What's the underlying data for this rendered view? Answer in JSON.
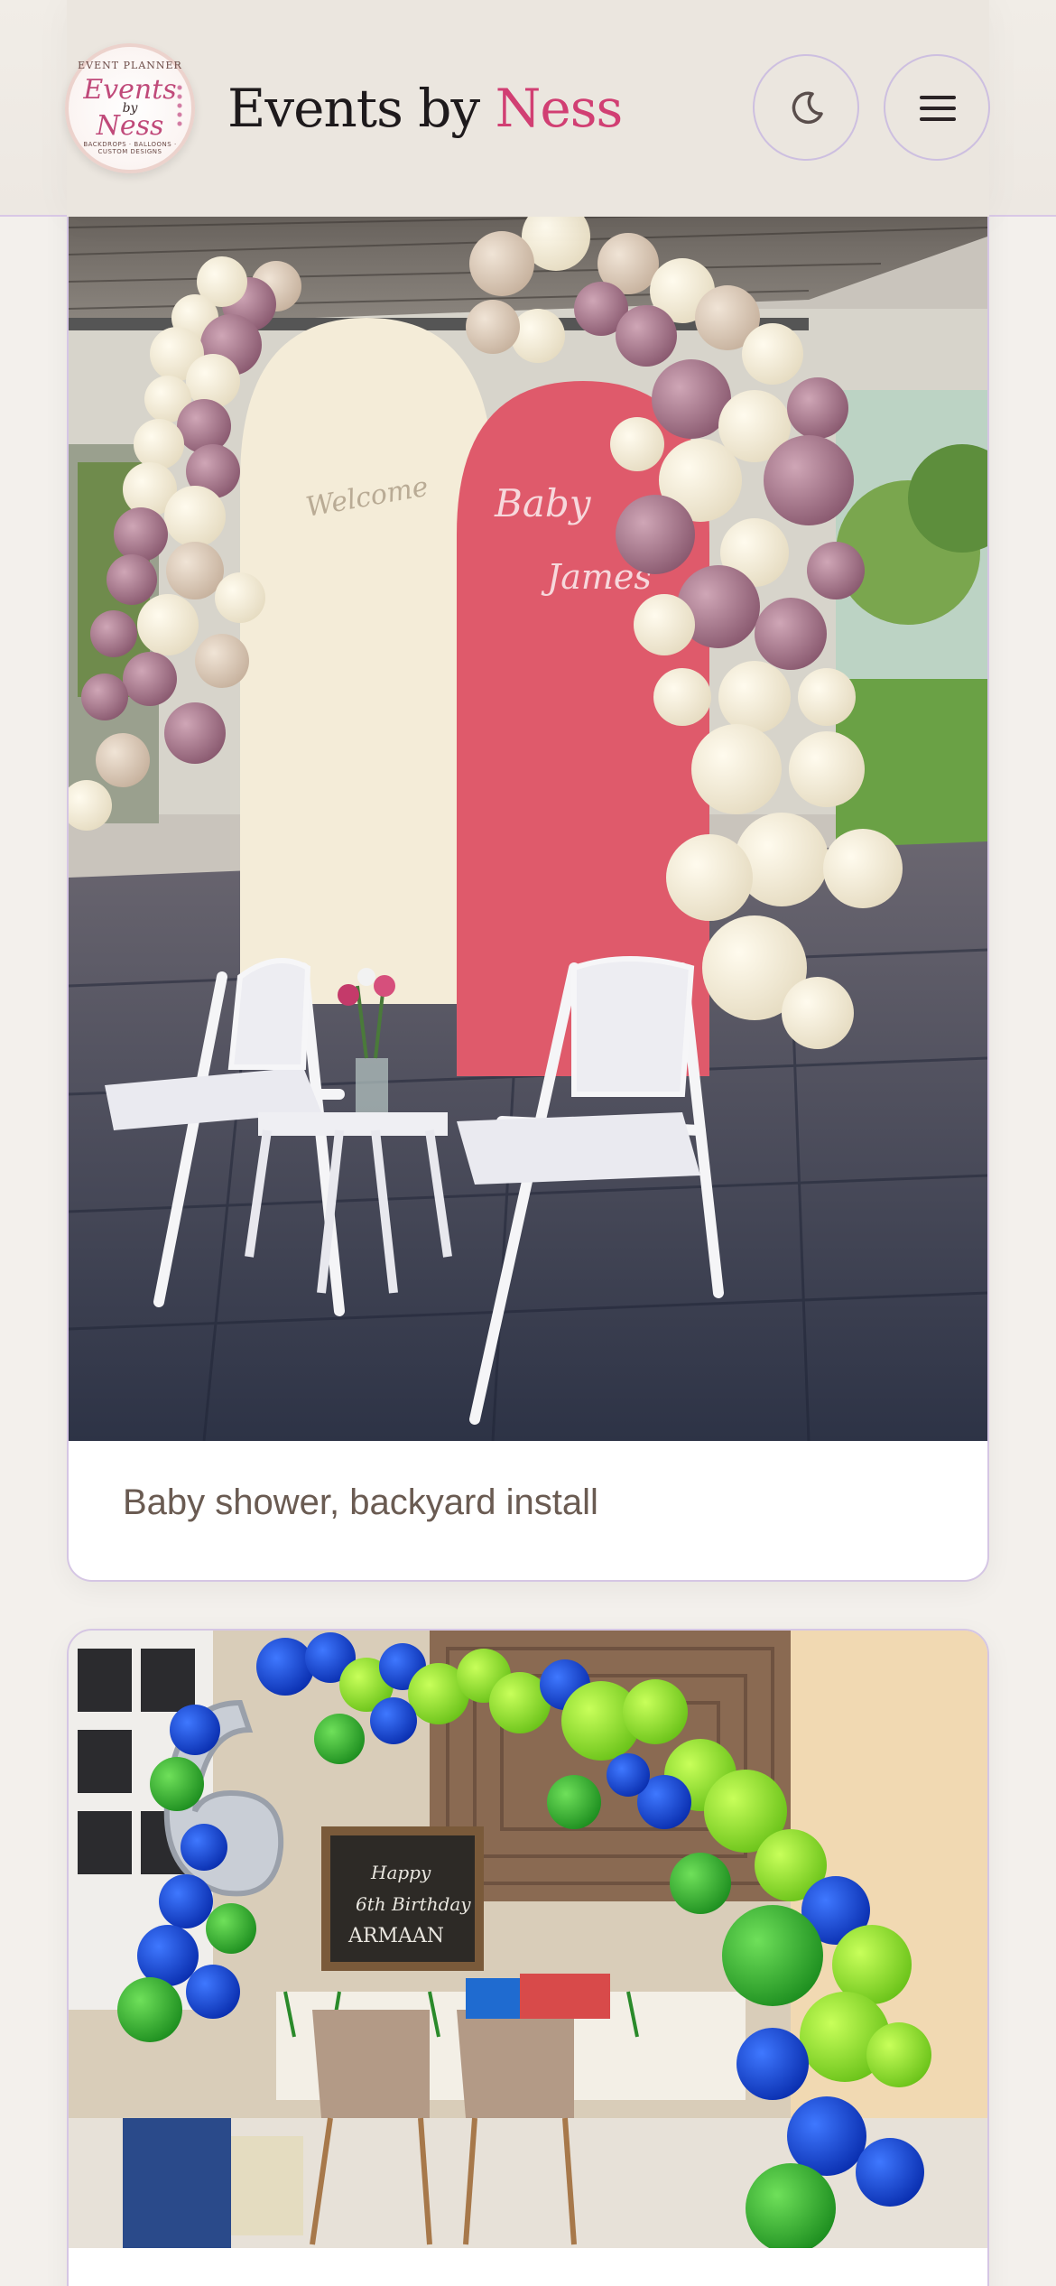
{
  "header": {
    "brand_prefix": "Events by ",
    "brand_accent": "Ness",
    "logo": {
      "top_text": "EVENT PLANNER",
      "script_line1": "Events",
      "script_by": "by",
      "script_line2": "Ness",
      "bottom_text": "BACKDROPS · BALLOONS · CUSTOM DESIGNS"
    },
    "theme_toggle_icon": "moon-icon",
    "menu_icon": "hamburger-menu-icon"
  },
  "gallery": [
    {
      "caption": "Baby shower, backyard install",
      "photo_text": [
        "Welcome",
        "Baby",
        "James"
      ]
    },
    {
      "caption": "",
      "photo_text": [
        "Happy",
        "6th Birthday",
        "ARMAAN"
      ]
    }
  ],
  "colors": {
    "accent": "#d13f73",
    "border": "#d5c6e4",
    "background": "#f3f0ec",
    "caption": "#6a5b52"
  }
}
